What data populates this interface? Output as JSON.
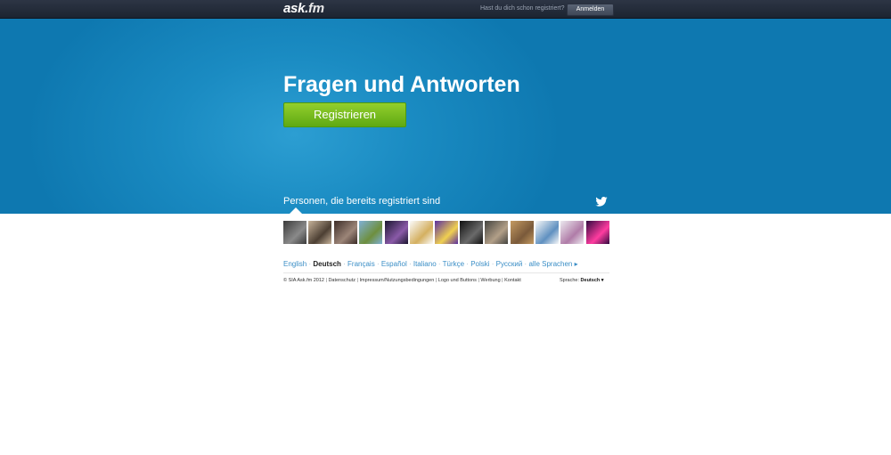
{
  "topbar": {
    "logo_main": "ask.",
    "logo_suffix": "fm",
    "question": "Hast du dich schon registriert?",
    "login_label": "Anmelden"
  },
  "hero": {
    "title": "Fragen und Antworten",
    "register_label": "Registrieren",
    "people_label": "Personen, die bereits registriert sind"
  },
  "avatars": [
    {
      "colors": [
        "#3a3a3a",
        "#8a8a8a"
      ]
    },
    {
      "colors": [
        "#c7b39a",
        "#4c3f33"
      ]
    },
    {
      "colors": [
        "#3b2c27",
        "#9c8578"
      ]
    },
    {
      "colors": [
        "#7fb0d6",
        "#6e8f3e"
      ]
    },
    {
      "colors": [
        "#1b1630",
        "#8a5aa8"
      ]
    },
    {
      "colors": [
        "#fbfbfb",
        "#d4b060"
      ]
    },
    {
      "colors": [
        "#5a2fa0",
        "#f0d050"
      ]
    },
    {
      "colors": [
        "#111111",
        "#6a6a6a"
      ]
    },
    {
      "colors": [
        "#444440",
        "#b29f88"
      ]
    },
    {
      "colors": [
        "#c49a62",
        "#7a5a3a"
      ]
    },
    {
      "colors": [
        "#f8f8f8",
        "#5f90c0"
      ]
    },
    {
      "colors": [
        "#ece9ef",
        "#b07ca8"
      ]
    },
    {
      "colors": [
        "#300a40",
        "#ff3ca0"
      ]
    }
  ],
  "languages": [
    {
      "label": "English",
      "active": false
    },
    {
      "label": "Deutsch",
      "active": true
    },
    {
      "label": "Français",
      "active": false
    },
    {
      "label": "Español",
      "active": false
    },
    {
      "label": "Italiano",
      "active": false
    },
    {
      "label": "Türkçe",
      "active": false
    },
    {
      "label": "Polski",
      "active": false
    },
    {
      "label": "Русский",
      "active": false
    }
  ],
  "all_languages": "alle Sprachen ▸",
  "footer": {
    "copyright": "© SIA Ask.fm 2012",
    "links": [
      "Datenschutz",
      "Impressum/Nutzungsbedingungen",
      "Logo und Buttons",
      "Werbung",
      "Kontakt"
    ],
    "language_prefix": "Sprache:",
    "language_value": "Deutsch ▾"
  },
  "colors": {
    "accent_blue": "#1a8bc2",
    "register_green": "#6fb81b",
    "link_blue": "#3a8ec6"
  },
  "icons": {
    "twitter": "twitter-icon",
    "caret": "caret-up-icon"
  }
}
